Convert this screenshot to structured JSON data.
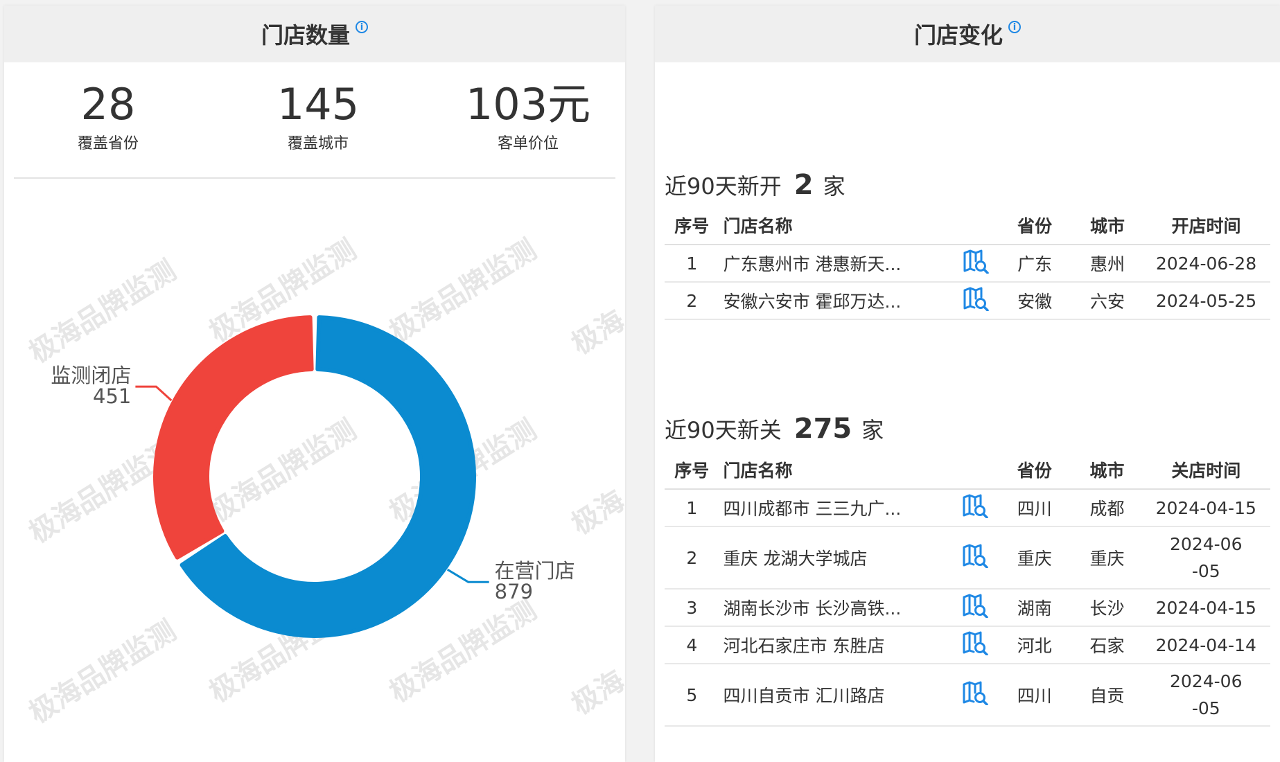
{
  "left_panel": {
    "title": "门店数量",
    "stats": [
      {
        "value": "28",
        "label": "覆盖省份"
      },
      {
        "value": "145",
        "label": "覆盖城市"
      },
      {
        "value": "103元",
        "label": "客单价位"
      }
    ],
    "watermark": "极海品牌监测",
    "watermark_partial": "极海",
    "chart_data": {
      "type": "pie",
      "style": "donut",
      "slices": [
        {
          "name": "在营门店",
          "value": 879,
          "color": "#0b8bd0"
        },
        {
          "name": "监测闭店",
          "value": 451,
          "color": "#ef443c"
        }
      ]
    }
  },
  "right_panel": {
    "title": "门店变化",
    "new_section": {
      "prefix": "近90天新开",
      "count": "2",
      "suffix": "家",
      "columns": [
        "序号",
        "门店名称",
        "省份",
        "城市",
        "开店时间"
      ],
      "rows": [
        {
          "idx": "1",
          "name": "广东惠州市 港惠新天...",
          "province": "广东",
          "city": "惠州",
          "date": "2024-06-28"
        },
        {
          "idx": "2",
          "name": "安徽六安市 霍邱万达...",
          "province": "安徽",
          "city": "六安",
          "date": "2024-05-25"
        }
      ]
    },
    "closed_section": {
      "prefix": "近90天新关",
      "count": "275",
      "suffix": "家",
      "columns": [
        "序号",
        "门店名称",
        "省份",
        "城市",
        "关店时间"
      ],
      "rows": [
        {
          "idx": "1",
          "name": "四川成都市 三三九广...",
          "province": "四川",
          "city": "成都",
          "date": "2024-04-15"
        },
        {
          "idx": "2",
          "name": "重庆 龙湖大学城店",
          "province": "重庆",
          "city": "重庆",
          "date": "2024-06-05"
        },
        {
          "idx": "3",
          "name": "湖南长沙市 长沙高铁...",
          "province": "湖南",
          "city": "长沙",
          "date": "2024-04-15"
        },
        {
          "idx": "4",
          "name": "河北石家庄市 东胜店",
          "province": "河北",
          "city": "石家",
          "date": "2024-04-14"
        },
        {
          "idx": "5",
          "name": "四川自贡市 汇川路店",
          "province": "四川",
          "city": "自贡",
          "date": "2024-06-05"
        }
      ]
    },
    "icon": "map-search-icon",
    "icon_color": "#1e88e5"
  }
}
